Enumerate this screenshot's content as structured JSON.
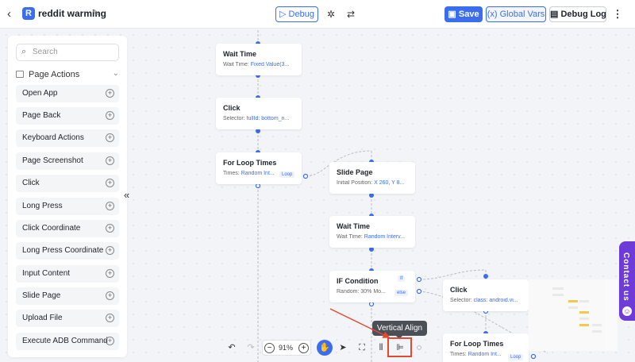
{
  "header": {
    "logo_letter": "R",
    "title": "reddit warming",
    "debug_label": "Debug",
    "save_label": "Save",
    "global_vars_label": "Global Vars",
    "debug_log_label": "Debug Log",
    "colors": {
      "accent": "#3b6df0"
    }
  },
  "sidebar": {
    "search_placeholder": "Search",
    "section_title": "Page Actions",
    "items": [
      {
        "label": "Open App"
      },
      {
        "label": "Page Back"
      },
      {
        "label": "Keyboard Actions"
      },
      {
        "label": "Page Screenshot"
      },
      {
        "label": "Click"
      },
      {
        "label": "Long Press"
      },
      {
        "label": "Click Coordinate"
      },
      {
        "label": "Long Press Coordinate"
      },
      {
        "label": "Input Content"
      },
      {
        "label": "Slide Page"
      },
      {
        "label": "Upload File"
      },
      {
        "label": "Execute ADB Command"
      }
    ]
  },
  "flow": {
    "nodes": [
      {
        "title": "Wait Time",
        "desc_label": "Wait Time:",
        "desc_value": "Fixed Value(3..."
      },
      {
        "title": "Click",
        "desc_label": "Selector:",
        "desc_value": "fullId: bottom_n..."
      },
      {
        "title": "For Loop Times",
        "desc_label": "Times:",
        "desc_value": "Random Int...",
        "tag": "Loop"
      },
      {
        "title": "Slide Page",
        "desc_label": "Initial Position:",
        "desc_value": "X 260, Y 8..."
      },
      {
        "title": "Wait Time",
        "desc_label": "Wait Time:",
        "desc_value": "Random Interv..."
      },
      {
        "title": "IF Condition",
        "desc_label": "Random:",
        "desc_value": "30%  Mo...",
        "tag": "If",
        "tag2": "else"
      },
      {
        "title": "Click",
        "desc_label": "Selector:",
        "desc_value": "class: android.vi..."
      },
      {
        "title": "For Loop Times",
        "desc_label": "Times:",
        "desc_value": "Random Int...",
        "tag": "Loop"
      }
    ]
  },
  "toolbar": {
    "zoom_value": "91%",
    "tooltip": "Vertical Align"
  },
  "contact": {
    "label": "Contact us"
  }
}
